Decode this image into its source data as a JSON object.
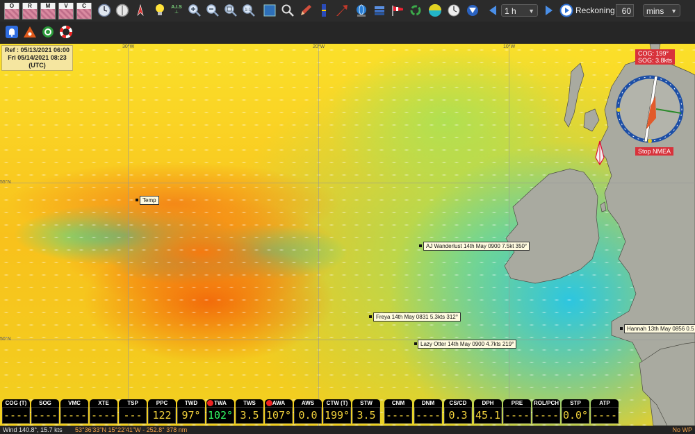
{
  "toolbar": {
    "tiles": [
      "O",
      "R",
      "M",
      "V",
      "C"
    ],
    "interval": "1 h",
    "mode_label": "Reckoning",
    "value": "60",
    "unit": "mins",
    "ais_label": "A.I.S"
  },
  "map": {
    "ref_line1": "Ref : 05/13/2021 06:00",
    "ref_line2": "Fri 05/14/2021 08:23",
    "ref_line3": "(UTC)",
    "grid_labels": [
      "30°W",
      "20°W",
      "10°W",
      "55°N",
      "50°N"
    ],
    "markers": [
      "Temp",
      "AJ Wanderlust 14th May 0900 7.5kt 350°",
      "Freya 14th May 0831 5.3kts 312°",
      "Lazy Otter 14th May 0900 4.7kts 219°",
      "Hannah 13th May 0856 0.5"
    ],
    "cog": "COG: 199°",
    "sog": "SOG: 3.8kts",
    "stop_nmea": "Stop NMEA"
  },
  "databar": [
    {
      "label": "COG (T)",
      "value": "----"
    },
    {
      "label": "SOG",
      "value": "----"
    },
    {
      "label": "VMC",
      "value": "----"
    },
    {
      "label": "XTE",
      "value": "----"
    },
    {
      "label": "TSP",
      "value": "---"
    },
    {
      "label": "PPC",
      "value": "122"
    },
    {
      "label": "TWD",
      "value": "97°"
    },
    {
      "label": "TWA",
      "value": "102°"
    },
    {
      "label": "TWS",
      "value": "3.5"
    },
    {
      "label": "AWA",
      "value": "107°"
    },
    {
      "label": "AWS",
      "value": "0.0"
    },
    {
      "label": "CTW (T)",
      "value": "199°"
    },
    {
      "label": "STW",
      "value": "3.5"
    },
    {
      "label": "CNM",
      "value": "----"
    },
    {
      "label": "DNM",
      "value": "----"
    },
    {
      "label": "CS/CD",
      "value": "0.3"
    },
    {
      "label": "DPH",
      "value": "45.1"
    },
    {
      "label": "PRE",
      "value": "----"
    },
    {
      "label": "ROL/PCH",
      "value": "----"
    },
    {
      "label": "STP",
      "value": "0.0°"
    },
    {
      "label": "ATP",
      "value": "----"
    }
  ],
  "status": {
    "left": "Wind 140.8°, 15.7 kts",
    "coords": "53°36'33\"N 15°22'41\"W - 252.8° 378 nm",
    "right": "No WP"
  }
}
